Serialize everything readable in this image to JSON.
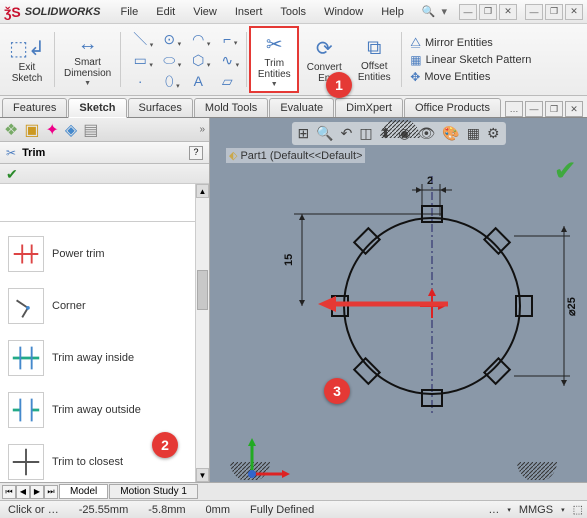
{
  "app": {
    "name": "SOLIDWORKS"
  },
  "menu": [
    "File",
    "Edit",
    "View",
    "Insert",
    "Tools",
    "Window",
    "Help"
  ],
  "win": {
    "min": "—",
    "max": "❐",
    "close": "✕"
  },
  "ribbon": {
    "exit_sketch": "Exit\nSketch",
    "smart_dimension": "Smart\nDimension",
    "trim_entities": "Trim\nEntities",
    "convert_entities": "Convert\nEn",
    "offset_entities": "Offset\nEntities",
    "mirror": "Mirror Entities",
    "pattern": "Linear Sketch Pattern",
    "move": "Move Entities"
  },
  "tabs": [
    "Features",
    "Sketch",
    "Surfaces",
    "Mold Tools",
    "Evaluate",
    "DimXpert",
    "Office Products"
  ],
  "active_tab": 1,
  "panel": {
    "title": "Trim",
    "options": [
      {
        "label": "Power trim"
      },
      {
        "label": "Corner"
      },
      {
        "label": "Trim away inside"
      },
      {
        "label": "Trim away outside"
      },
      {
        "label": "Trim to closest"
      }
    ]
  },
  "doc": {
    "name": "Part1  (Default<<Default>"
  },
  "bottom_tabs": [
    "Model",
    "Motion Study 1"
  ],
  "status": {
    "click": "Click or …",
    "x": "-25.55mm",
    "y": "-5.8mm",
    "z": "0mm",
    "state": "Fully Defined",
    "units": "MMGS",
    "edit": "…"
  },
  "badges": {
    "b1": "1",
    "b2": "2",
    "b3": "3"
  },
  "dims": {
    "d15": "15",
    "d2": "2",
    "d25": "⌀25"
  }
}
